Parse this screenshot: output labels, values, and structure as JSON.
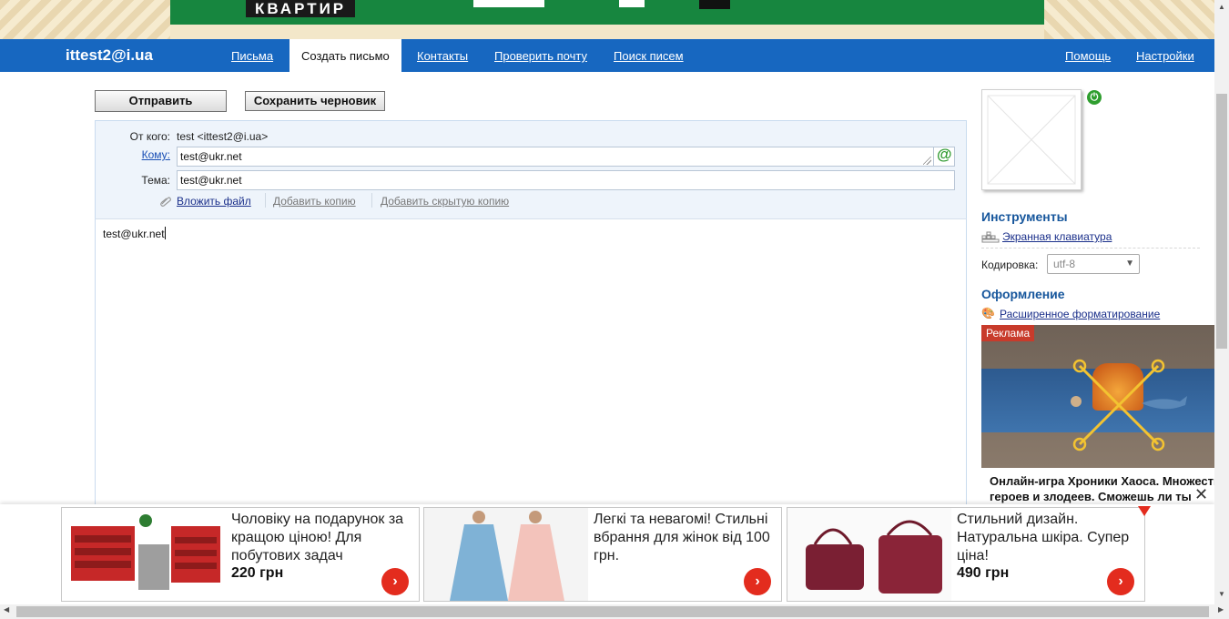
{
  "banner": {
    "text": "КВАРТИР"
  },
  "nav": {
    "account": "ittest2@i.ua",
    "items": [
      "Письма",
      "Создать письмо",
      "Контакты",
      "Проверить почту",
      "Поиск писем"
    ],
    "right": [
      "Помощь",
      "Настройки"
    ]
  },
  "actions": {
    "send": "Отправить",
    "save_draft": "Сохранить черновик"
  },
  "compose": {
    "from_label": "От кого:",
    "from_value": "test <ittest2@i.ua>",
    "to_label": "Кому:",
    "to_value": "test@ukr.net",
    "subject_label": "Тема:",
    "subject_value": "test@ukr.net",
    "attach": "Вложить файл",
    "add_cc": "Добавить копию",
    "add_bcc": "Добавить скрытую копию",
    "body": "test@ukr.net"
  },
  "sidebar": {
    "tools_title": "Инструменты",
    "keyboard_link": "Экранная клавиатура",
    "encoding_label": "Кодировка:",
    "encoding_value": "utf-8",
    "design_title": "Оформление",
    "format_link": "Расширенное форматирование",
    "ad_badge": "Реклама",
    "ad_caption_1": "Онлайн-игра Хроники Хаоса. Множество",
    "ad_caption_2": "героев и злодеев. Сможешь ли ты"
  },
  "bottom_ads": [
    {
      "text": "Чоловіку на подарунок за кращою ціною! Для побутових задач",
      "price": "220 грн"
    },
    {
      "text": "Легкі та невагомі! Стильні вбрання для жінок від 100 грн.",
      "price": ""
    },
    {
      "text": "Стильний дизайн. Натуральна шкіра. Супер ціна!",
      "price": "490 грн"
    }
  ],
  "icons": {
    "at": "@",
    "go": "›",
    "close": "✕"
  }
}
